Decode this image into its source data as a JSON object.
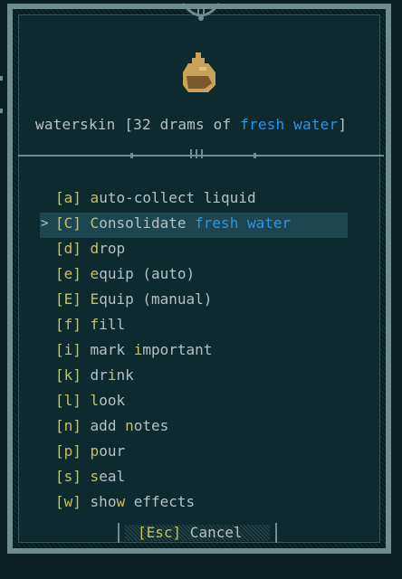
{
  "item": {
    "icon": "waterskin-icon",
    "name_prefix": "waterskin [32 drams of ",
    "liquid": "fresh water",
    "name_suffix": "]"
  },
  "menu": {
    "items": [
      {
        "key": "[a]",
        "first": "a",
        "rest": "uto-collect liquid",
        "selected": false
      },
      {
        "key": "[C]",
        "first": "C",
        "rest": "onsolidate ",
        "liquid": "fresh water",
        "selected": true
      },
      {
        "key": "[d]",
        "first": "d",
        "rest": "rop",
        "selected": false
      },
      {
        "key": "[e]",
        "first": "e",
        "rest": "quip (auto)",
        "selected": false
      },
      {
        "key": "[E]",
        "first": "E",
        "rest": "quip (manual)",
        "selected": false
      },
      {
        "key": "[f]",
        "first": "f",
        "rest": "ill",
        "selected": false
      },
      {
        "key": "[i]",
        "pre": "mark ",
        "first": "i",
        "rest": "mportant",
        "selected": false
      },
      {
        "key": "[k]",
        "first": "",
        "pre": "dr",
        "first2": "i",
        "rest": "nk",
        "selected": false
      },
      {
        "key": "[l]",
        "first": "l",
        "rest": "ook",
        "selected": false
      },
      {
        "key": "[n]",
        "pre": "add ",
        "first": "n",
        "rest": "otes",
        "selected": false
      },
      {
        "key": "[p]",
        "first": "p",
        "rest": "our",
        "selected": false
      },
      {
        "key": "[s]",
        "first": "s",
        "rest": "eal",
        "selected": false
      },
      {
        "key": "[w]",
        "pre": "sho",
        "first": "w",
        "rest": " effects",
        "selected": false
      }
    ],
    "cursor": ">"
  },
  "cancel": {
    "key": "[Esc]",
    "label": " Cancel"
  },
  "colors": {
    "background": "#0d2a2e",
    "text": "#b4c2c3",
    "hotkey": "#c7c15a",
    "liquid": "#2a94e8",
    "selection": "#1d4650",
    "border": "#6f8c8e"
  }
}
